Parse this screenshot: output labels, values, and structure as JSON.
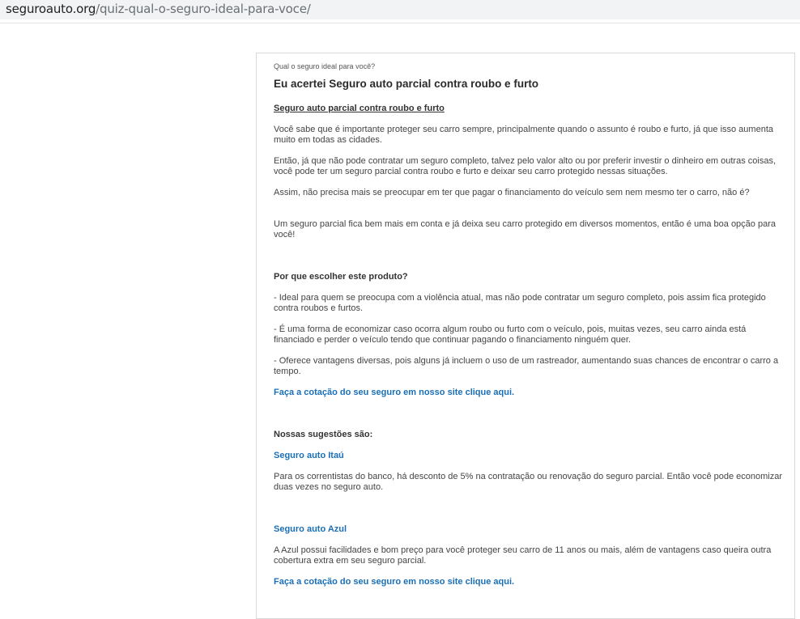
{
  "browser": {
    "url_host": "seguroauto.org",
    "url_path": "/quiz-qual-o-seguro-ideal-para-voce/"
  },
  "article": {
    "kicker": "Qual o seguro ideal para você?",
    "title": "Eu acertei Seguro auto parcial contra roubo e furto",
    "subtitle": "Seguro auto parcial contra roubo e furto",
    "paragraphs": [
      "Você sabe que é importante proteger seu carro sempre, principalmente quando o assunto é roubo e furto, já que isso aumenta muito em todas as cidades.",
      "Então, já que não pode contratar um seguro completo, talvez pelo valor alto ou por preferir investir o dinheiro em outras coisas, você pode ter um seguro parcial contra roubo e furto e deixar seu carro protegido nessas situações.",
      "Assim, não precisa mais se preocupar em ter que pagar o financiamento do veículo sem nem mesmo ter o carro, não é?",
      "Um seguro parcial fica bem mais em conta e já deixa seu carro protegido em diversos momentos, então é uma boa opção para você!"
    ],
    "why_heading": "Por que escolher este produto?",
    "reasons": [
      "- Ideal para quem se preocupa com a violência atual, mas não pode contratar um seguro completo, pois assim fica protegido contra roubos e furtos.",
      "- É uma forma de economizar caso ocorra algum roubo ou furto com o veículo, pois, muitas vezes, seu carro ainda está financiado e perder o veículo tendo que continuar pagando o financiamento ninguém quer.",
      "- Oferece vantagens diversas, pois alguns já incluem o uso de um rastreador, aumentando suas chances de encontrar o carro a tempo."
    ],
    "cta_link_1": "Faça a cotação do seu seguro em nosso site clique aqui.",
    "suggestions_heading": "Nossas sugestões são:",
    "suggestions": [
      {
        "name": "Seguro auto Itaú",
        "description": " Para os correntistas do banco, há desconto de 5% na contratação ou renovação do seguro parcial. Então você pode economizar duas vezes no seguro auto."
      },
      {
        "name": "Seguro auto Azul",
        "description": " A Azul possui facilidades e bom preço para você proteger seu carro de 11 anos ou mais, além de vantagens caso queira outra cobertura extra em seu seguro parcial."
      }
    ],
    "cta_link_2": "Faça a cotação do seu seguro em nosso site clique aqui."
  }
}
